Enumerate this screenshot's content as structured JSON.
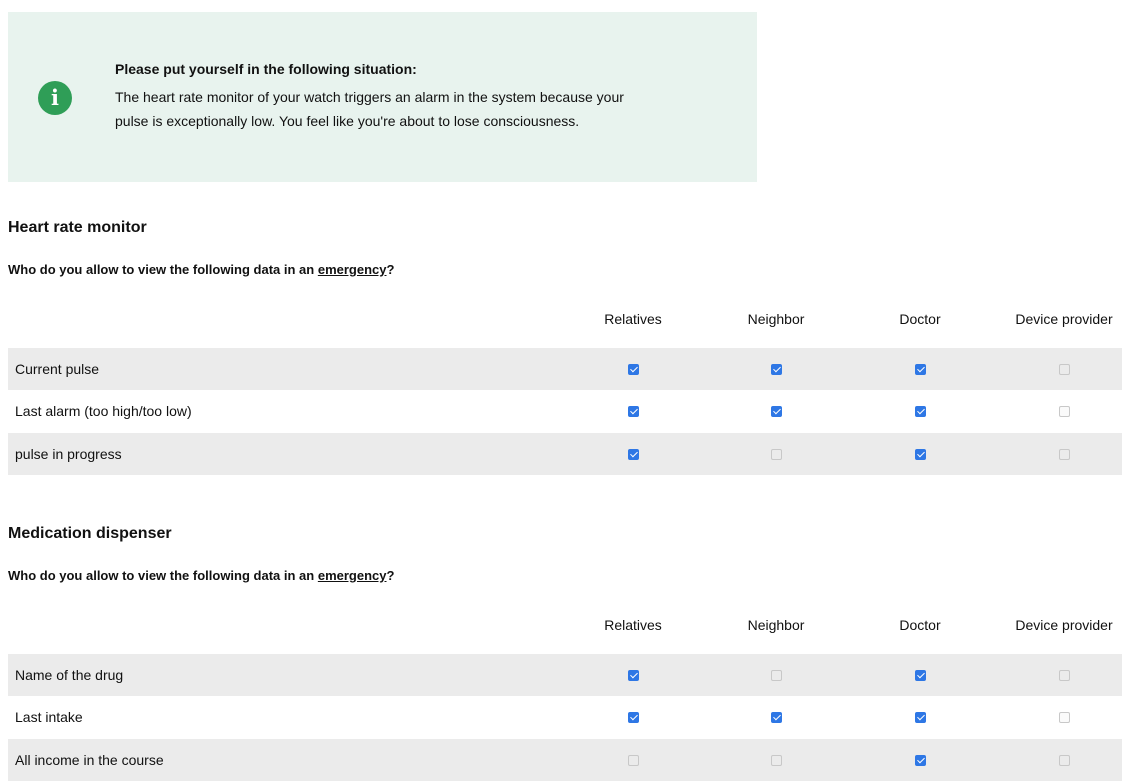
{
  "info": {
    "icon": "info-icon",
    "icon_glyph": "i",
    "title": "Please put yourself in the following situation:",
    "line1": "The heart rate monitor of your watch triggers an alarm in the system because your",
    "line2": "pulse is exceptionally low. You feel like you're about to lose consciousness."
  },
  "columns": [
    "Relatives",
    "Neighbor",
    "Doctor",
    "Device provider"
  ],
  "sections": [
    {
      "title": "Heart rate monitor",
      "question_prefix": "Who do you allow to view the following data in an ",
      "question_link": "emergency",
      "question_suffix": "?",
      "rows": [
        {
          "label": "Current pulse",
          "checks": [
            true,
            true,
            true,
            false
          ]
        },
        {
          "label": "Last alarm (too high/too low)",
          "checks": [
            true,
            true,
            true,
            false
          ]
        },
        {
          "label": "pulse in progress",
          "checks": [
            true,
            false,
            true,
            false
          ]
        }
      ]
    },
    {
      "title": "Medication dispenser",
      "question_prefix": "Who do you allow to view the following data in an ",
      "question_link": "emergency",
      "question_suffix": "?",
      "rows": [
        {
          "label": "Name of the drug",
          "checks": [
            true,
            false,
            true,
            false
          ]
        },
        {
          "label": "Last intake",
          "checks": [
            true,
            true,
            true,
            false
          ]
        },
        {
          "label": "All income in the course",
          "checks": [
            false,
            false,
            true,
            false
          ]
        }
      ]
    }
  ],
  "colors": {
    "info_background": "#e8f3ee",
    "info_icon": "#2f9e57",
    "checkbox_checked": "#2e77e5",
    "row_shade": "#ebebeb"
  }
}
